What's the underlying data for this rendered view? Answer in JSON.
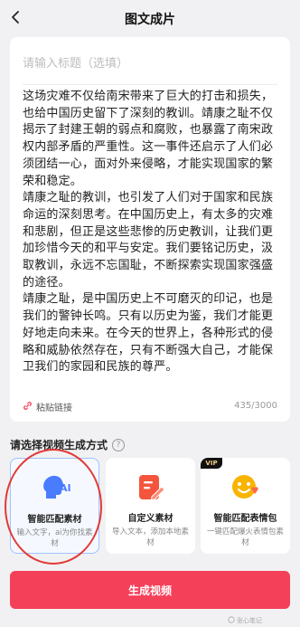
{
  "header": {
    "title": "图文成片"
  },
  "editor": {
    "title_placeholder": "请输入标题（选填）",
    "paragraphs": [
      "这场灾难不仅给南宋带来了巨大的打击和损失，也给中国历史留下了深刻的教训。靖康之耻不仅揭示了封建王朝的弱点和腐败，也暴露了南宋政权内部矛盾的严重性。这一事件还启示了人们必须团结一心，面对外来侵略，才能实现国家的繁荣和稳定。",
      "靖康之耻的教训，也引发了人们对于国家和民族命运的深刻思考。在中国历史上，有太多的灾难和悲剧，但正是这些悲惨的历史教训，让我们更加珍惜今天的和平与安定。我们要铭记历史，汲取教训，永远不忘国耻，不断探索实现国家强盛的途径。",
      "靖康之耻，是中国历史上不可磨灭的印记，也是我们的警钟长鸣。只有以历史为鉴，我们才能更好地走向未来。在今天的世界上，各种形式的侵略和威胁依然存在，只有不断强大自己，才能保卫我们的家园和民族的尊严。"
    ],
    "paste_label": "粘贴链接",
    "char_count": "435/3000"
  },
  "section": {
    "title": "请选择视频生成方式",
    "help_icon": "?"
  },
  "options": [
    {
      "name": "智能匹配素材",
      "desc": "输入文字，ai为你找素材",
      "icon_text": "AI",
      "color": "#4a7cff"
    },
    {
      "name": "自定义素材",
      "desc": "导入文本，添加本地素材",
      "color": "#f4553c"
    },
    {
      "name": "智能匹配表情包",
      "desc": "一键匹配爆火表情包素材",
      "vip": "VIP",
      "color": "#f9b400"
    }
  ],
  "generate_button": "生成视频",
  "watermark": "张心笔记"
}
